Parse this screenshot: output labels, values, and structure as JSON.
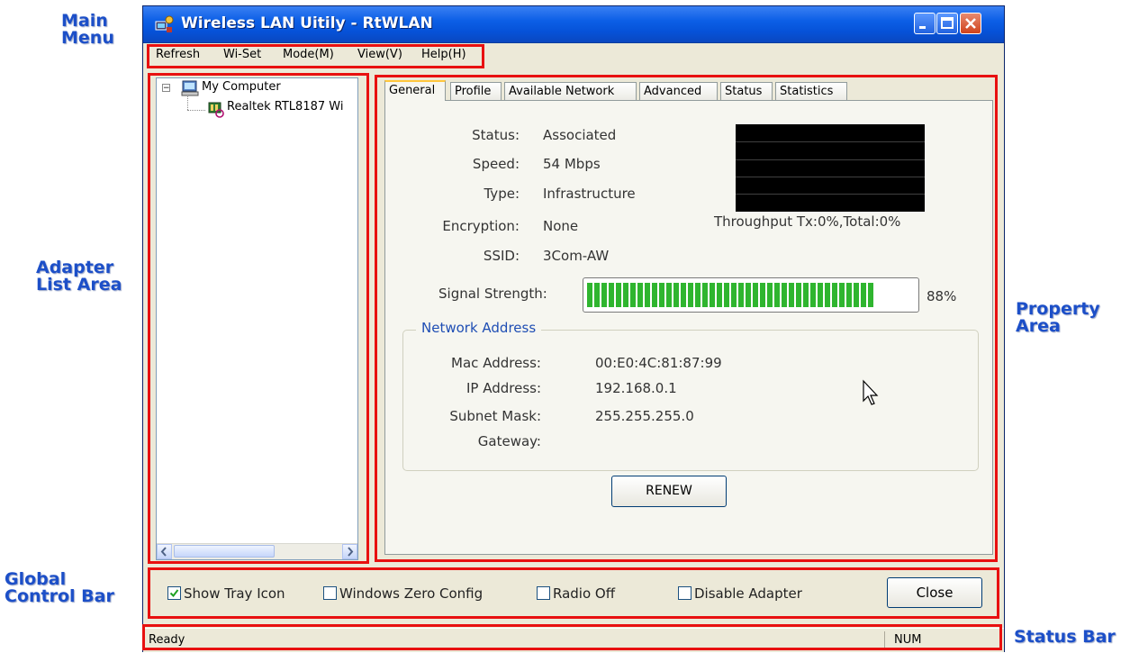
{
  "callouts": {
    "main_menu": [
      "Main",
      "Menu"
    ],
    "adapter_list": [
      "Adapter",
      "List Area"
    ],
    "property": [
      "Property",
      "Area"
    ],
    "global_control": [
      "Global",
      "Control Bar"
    ],
    "status_bar": "Status Bar"
  },
  "window": {
    "title": "Wireless LAN Uitily - RtWLAN",
    "title_icon": "network-adapter-icon"
  },
  "menu": [
    "Refresh",
    "Wi-Set",
    "Mode(M)",
    "View(V)",
    "Help(H)"
  ],
  "tree": {
    "root": "My Computer",
    "child": "Realtek RTL8187 Wi",
    "root_icon": "computer-icon",
    "child_icon": "wireless-adapter-icon"
  },
  "tabs": [
    "General",
    "Profile",
    "Available Network",
    "Advanced",
    "Status",
    "Statistics"
  ],
  "active_tab": "General",
  "general": {
    "status_label": "Status:",
    "status_value": "Associated",
    "speed_label": "Speed:",
    "speed_value": "54 Mbps",
    "type_label": "Type:",
    "type_value": "Infrastructure",
    "encryption_label": "Encryption:",
    "encryption_value": "None",
    "ssid_label": "SSID:",
    "ssid_value": "3Com-AW",
    "throughput": "Throughput  Tx:0%,Total:0%",
    "signal_label": "Signal Strength:",
    "signal_value": "88%",
    "signal_fraction": 0.88
  },
  "network_address": {
    "title": "Network Address",
    "mac_label": "Mac Address:",
    "mac_value": "00:E0:4C:81:87:99",
    "ip_label": "IP Address:",
    "ip_value": "192.168.0.1",
    "subnet_label": "Subnet Mask:",
    "subnet_value": "255.255.255.0",
    "gateway_label": "Gateway:",
    "gateway_value": ""
  },
  "buttons": {
    "renew": "RENEW",
    "close": "Close"
  },
  "checkboxes": [
    {
      "label": "Show Tray Icon",
      "checked": true
    },
    {
      "label": "Windows Zero Config",
      "checked": false
    },
    {
      "label": "Radio Off",
      "checked": false
    },
    {
      "label": "Disable Adapter",
      "checked": false
    }
  ],
  "status": {
    "text": "Ready",
    "num": "NUM"
  },
  "colors": {
    "annotation": "#e81010",
    "callout": "#1c4fc8",
    "signal_bar": "#2fb52f",
    "title_bar": "#0c5fe6"
  }
}
